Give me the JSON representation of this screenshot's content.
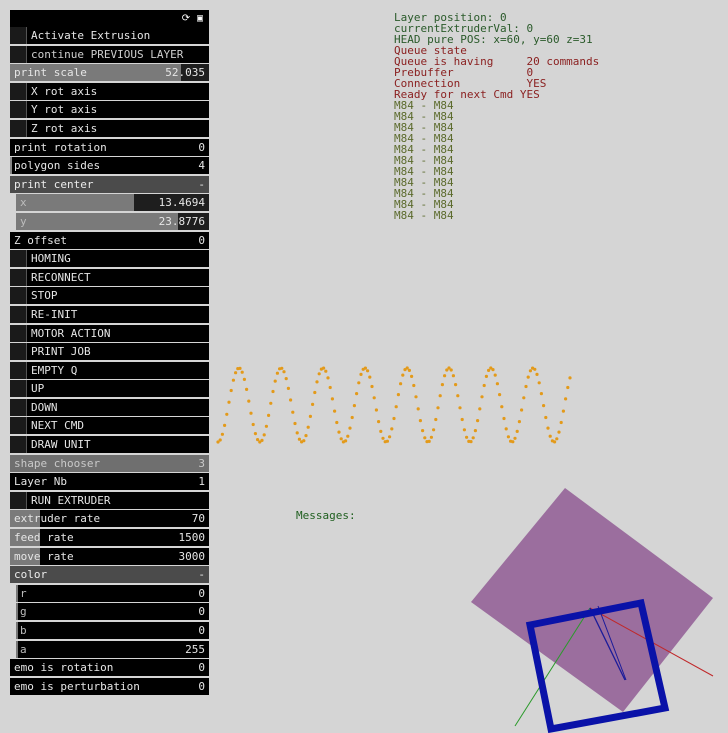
{
  "panel": {
    "activate_extrusion": "Activate Extrusion",
    "continue_previous_layer": "continue PREVIOUS LAYER",
    "print_scale": {
      "label": "print scale",
      "value": "52.035",
      "fill": 0.86
    },
    "x_rot_axis": "X rot axis",
    "y_rot_axis": "Y rot axis",
    "z_rot_axis": "Z rot axis",
    "print_rotation": {
      "label": "print rotation",
      "value": "0"
    },
    "polygon_sides": {
      "label": "polygon sides",
      "value": "4"
    },
    "print_center": {
      "title": "print center",
      "minus": "-",
      "x_label": "x",
      "x_value": "13.4694",
      "x_fill": 0.61,
      "y_label": "y",
      "y_value": "23.8776",
      "y_fill": 0.84
    },
    "z_offset": {
      "label": "Z offset",
      "value": "0"
    },
    "buttons": [
      "HOMING",
      "RECONNECT",
      "STOP",
      "RE-INIT",
      "MOTOR ACTION",
      "PRINT JOB",
      "EMPTY Q",
      "UP",
      "DOWN",
      "NEXT CMD",
      "DRAW UNIT"
    ],
    "shape_chooser": {
      "label": "shape chooser",
      "value": "3"
    },
    "layer_nb": {
      "label": "Layer Nb",
      "value": "1"
    },
    "run_extruder": "RUN EXTRUDER",
    "extruder_rate": {
      "label": "extruder rate",
      "value": "70",
      "fill": 0.15
    },
    "feed_rate": {
      "label": "feed rate",
      "value": "1500",
      "fill": 0.15
    },
    "move_rate": {
      "label": "move rate",
      "value": "3000",
      "fill": 0.15
    },
    "color": {
      "title": "color",
      "minus": "-",
      "r": "r",
      "r_value": "0",
      "g": "g",
      "g_value": "0",
      "b": "b",
      "b_value": "0",
      "a": "a",
      "a_value": "255"
    },
    "emo_rotation": {
      "label": "emo is rotation",
      "value": "0"
    },
    "emo_perturbation": {
      "label": "emo is perturbation",
      "value": "0"
    }
  },
  "hud": {
    "layer_position": "Layer position: 0",
    "extruder_val": "currentExtruderVal: 0",
    "head_pos": "HEAD pure POS: x=60, y=60 z=31",
    "queue_state": "Queue state",
    "queue_having": "Queue is having     20 commands",
    "prebuffer": "Prebuffer           0",
    "connection": "Connection          YES",
    "ready": "Ready for next Cmd YES",
    "commands": [
      "M84 - M84",
      "M84 - M84",
      "M84 - M84",
      "M84 - M84",
      "M84 - M84",
      "M84 - M84",
      "M84 - M84",
      "M84 - M84",
      "M84 - M84",
      "M84 - M84",
      "M84 - M84"
    ]
  },
  "messages": "Messages:",
  "colors": {
    "wave": "#e39a1a",
    "plane": "#9b6e9e",
    "square": "#0a12a8"
  }
}
